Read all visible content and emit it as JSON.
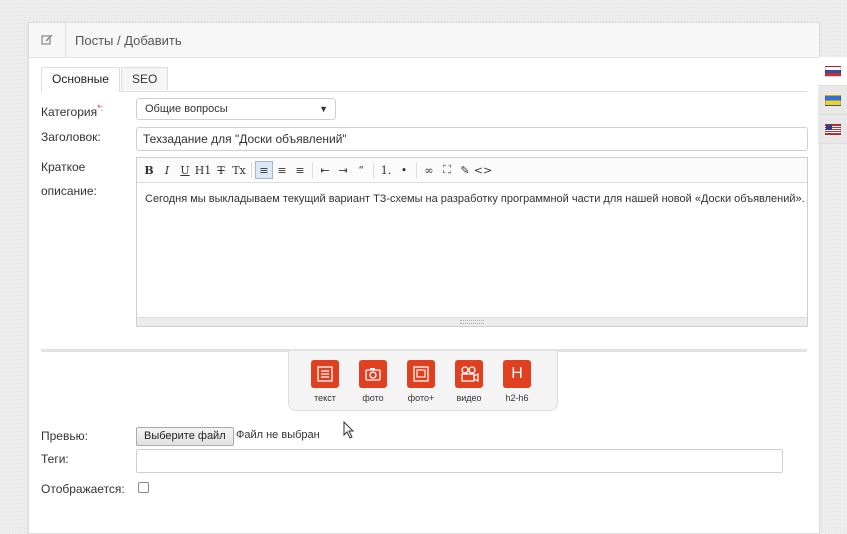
{
  "header": {
    "title": "Посты / Добавить",
    "edit_icon": "edit-icon"
  },
  "tabs": [
    {
      "label": "Основные"
    },
    {
      "label": "SEO"
    }
  ],
  "form": {
    "category_label": "Категория",
    "category_required": "*:",
    "category_value": "Общие вопросы",
    "title_label": "Заголовок:",
    "title_value": "Техзадание для \"Доски объявлений\"",
    "short_desc_label_1": "Краткое",
    "short_desc_label_2": "описание:",
    "short_desc_text": "Сегодня мы выкладываем текущий вариант ТЗ-схемы на разработку программной части для нашей новой «Доски объявлений».",
    "preview_label": "Превью:",
    "file_button": "Выберите файл",
    "file_status": "Файл не выбран",
    "tags_label": "Теги:",
    "visible_label": "Отображается:"
  },
  "toolbar": [
    {
      "glyph": "B",
      "icon": "bold-icon"
    },
    {
      "glyph": "I",
      "icon": "italic-icon"
    },
    {
      "glyph": "U",
      "icon": "underline-icon"
    },
    {
      "glyph": "H1",
      "icon": "heading-icon"
    },
    {
      "glyph": "T",
      "icon": "strikethrough-icon"
    },
    {
      "glyph": "Tx",
      "icon": "clear-format-icon"
    },
    {
      "glyph": "≡",
      "icon": "align-left-icon"
    },
    {
      "glyph": "≡",
      "icon": "align-center-icon"
    },
    {
      "glyph": "≡",
      "icon": "align-right-icon"
    },
    {
      "glyph": "⇤",
      "icon": "outdent-icon"
    },
    {
      "glyph": "⇥",
      "icon": "indent-icon"
    },
    {
      "glyph": "“",
      "icon": "blockquote-icon"
    },
    {
      "glyph": "1.",
      "icon": "ordered-list-icon"
    },
    {
      "glyph": "•",
      "icon": "bullet-list-icon"
    },
    {
      "glyph": "∞",
      "icon": "link-icon"
    },
    {
      "glyph": "⛶",
      "icon": "fullscreen-icon"
    },
    {
      "glyph": "✎",
      "icon": "eraser-icon"
    },
    {
      "glyph": "<>",
      "icon": "source-code-icon"
    }
  ],
  "blocks": [
    {
      "label": "текст",
      "icon": "text-block-icon"
    },
    {
      "label": "фото",
      "icon": "photo-icon"
    },
    {
      "label": "фото+",
      "icon": "gallery-icon"
    },
    {
      "label": "видео",
      "icon": "video-icon"
    },
    {
      "label": "h2-h6",
      "icon": "heading-block-icon"
    }
  ],
  "languages": [
    {
      "icon": "flag-ru-icon"
    },
    {
      "icon": "flag-ua-icon"
    },
    {
      "icon": "flag-us-icon"
    }
  ],
  "colors": {
    "accent": "#e0401f"
  }
}
